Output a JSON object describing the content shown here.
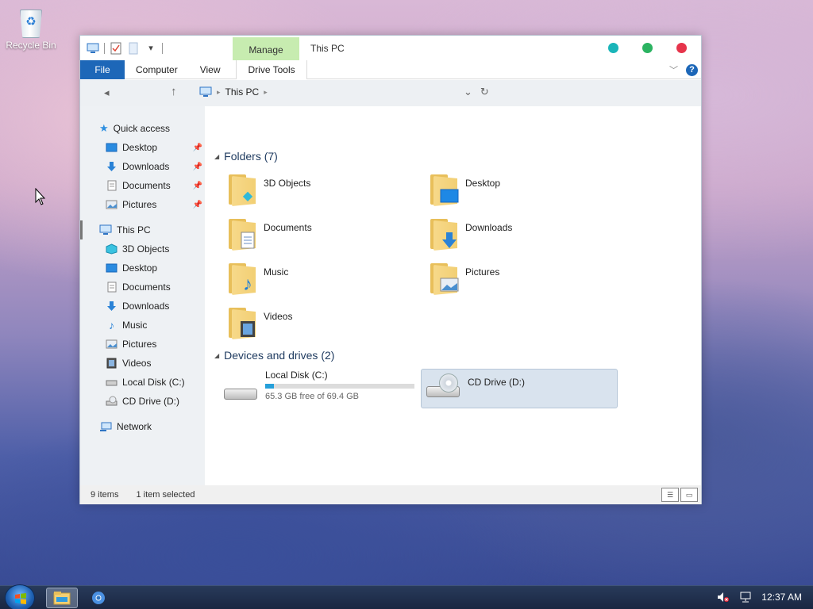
{
  "desktop": {
    "recycle_bin_label": "Recycle Bin"
  },
  "window": {
    "title": "This PC",
    "manage_tab": "Manage",
    "ribbon": {
      "file": "File",
      "computer": "Computer",
      "view": "View",
      "drive_tools": "Drive Tools",
      "help": "?"
    },
    "address": {
      "location": "This PC"
    }
  },
  "sidebar": {
    "quick_access": {
      "label": "Quick access",
      "items": [
        {
          "label": "Desktop",
          "icon": "desktop-icon",
          "pinned": true
        },
        {
          "label": "Downloads",
          "icon": "download-icon",
          "pinned": true
        },
        {
          "label": "Documents",
          "icon": "document-icon",
          "pinned": true
        },
        {
          "label": "Pictures",
          "icon": "pictures-icon",
          "pinned": true
        }
      ]
    },
    "this_pc": {
      "label": "This PC",
      "items": [
        {
          "label": "3D Objects",
          "icon": "3d-objects-icon"
        },
        {
          "label": "Desktop",
          "icon": "desktop-icon"
        },
        {
          "label": "Documents",
          "icon": "document-icon"
        },
        {
          "label": "Downloads",
          "icon": "download-icon"
        },
        {
          "label": "Music",
          "icon": "music-icon"
        },
        {
          "label": "Pictures",
          "icon": "pictures-icon"
        },
        {
          "label": "Videos",
          "icon": "videos-icon"
        },
        {
          "label": "Local Disk (C:)",
          "icon": "hard-drive-icon"
        },
        {
          "label": "CD Drive (D:)",
          "icon": "cd-drive-icon"
        }
      ]
    },
    "network": {
      "label": "Network"
    }
  },
  "main": {
    "folders_header": "Folders (7)",
    "folders": [
      {
        "label": "3D Objects"
      },
      {
        "label": "Desktop"
      },
      {
        "label": "Documents"
      },
      {
        "label": "Downloads"
      },
      {
        "label": "Music"
      },
      {
        "label": "Pictures"
      },
      {
        "label": "Videos"
      }
    ],
    "drives_header": "Devices and drives (2)",
    "drives": [
      {
        "label": "Local Disk (C:)",
        "free_text": "65.3 GB free of 69.4 GB",
        "used_fraction": 0.06
      },
      {
        "label": "CD Drive (D:)",
        "selected": true
      }
    ]
  },
  "status": {
    "items_count": "9 items",
    "selection": "1 item selected"
  },
  "taskbar": {
    "clock": "12:37 AM"
  },
  "colors": {
    "accent": "#1d67b8",
    "manage_tab": "#c7ecb0",
    "minimize": "#1ab5b9",
    "maximize": "#2bb361",
    "close": "#e6344b",
    "drive_bar": "#26a0da"
  }
}
